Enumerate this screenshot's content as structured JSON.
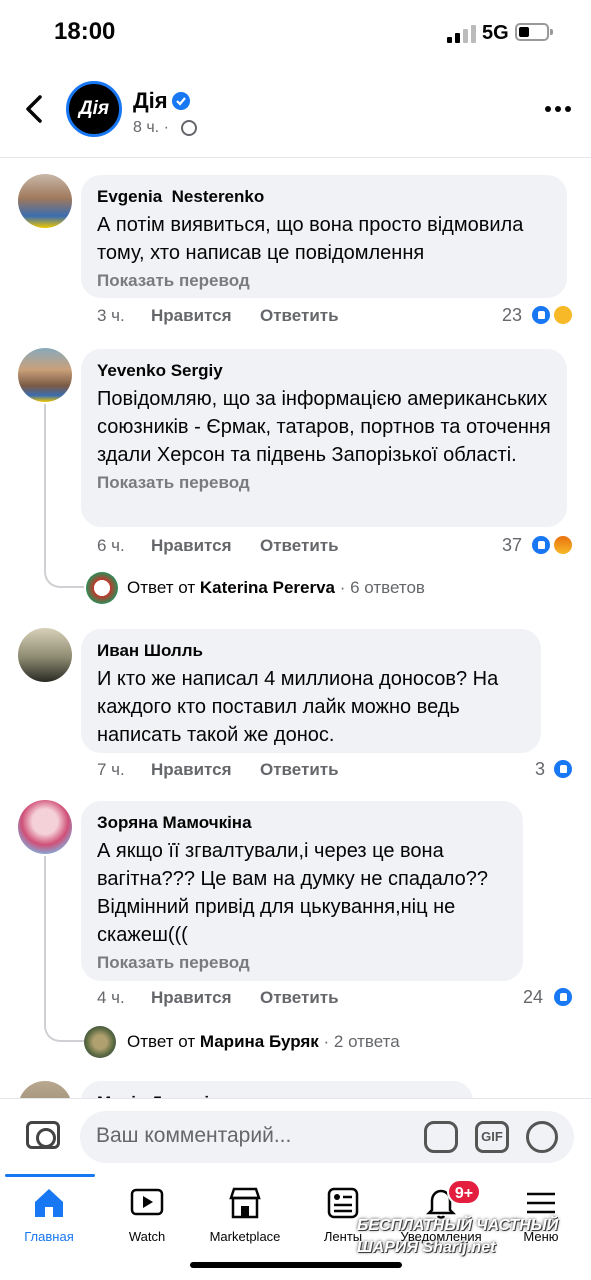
{
  "status_bar": {
    "time": "18:00",
    "network": "5G"
  },
  "header": {
    "page_name": "Дія",
    "avatar_text": "Дія",
    "meta": "8 ч. ·"
  },
  "comments": [
    {
      "author": "Evgenia  Nesterenko",
      "text": "А потім виявиться, що вона просто відмовила тому, хто написав  це повідомлення",
      "translate": "Показать перевод",
      "time": "3 ч.",
      "like": "Нравится",
      "reply": "Ответить",
      "reactions": "23"
    },
    {
      "author": "Yevenko Sergiy",
      "text": "Повідомляю, що за інформацією американських союзників - Єрмак, татаров, портнов та оточення здали Херсон та підвень Запорізької області.",
      "translate": "Показать перевод",
      "time": "6 ч.",
      "like": "Нравится",
      "reply": "Ответить",
      "reactions": "37",
      "replies": {
        "prefix": "Ответ от",
        "name": "Katerina Pererva",
        "count": " · 6 ответов"
      }
    },
    {
      "author": "Иван Шолль",
      "text": "И кто же написал 4 миллиона доносов? На каждого кто поставил лайк можно ведь написать такой же донос.",
      "time": "7 ч.",
      "like": "Нравится",
      "reply": "Ответить",
      "reactions": "3"
    },
    {
      "author": "Зоряна Мамочкіна",
      "text": "А якщо її згвалтували,і через це вона вагітна??? Це вам на думку не спадало?? Відмінний привід для цькування,ніц не скажеш(((",
      "translate": "Показать перевод",
      "time": "4 ч.",
      "like": "Нравится",
      "reply": "Ответить",
      "reactions": "24",
      "replies": {
        "prefix": "Ответ от",
        "name": "Марина Буряк",
        "count": " · 2 ответа"
      }
    },
    {
      "author": "Марія Дмитрієва"
    }
  ],
  "input": {
    "placeholder": "Ваш комментарий...",
    "gif_label": "GIF"
  },
  "nav": [
    {
      "label": "Главная",
      "icon": "home-icon"
    },
    {
      "label": "Watch",
      "icon": "watch-icon"
    },
    {
      "label": "Marketplace",
      "icon": "marketplace-icon"
    },
    {
      "label": "Ленты",
      "icon": "feeds-icon"
    },
    {
      "label": "Уведомления",
      "icon": "bell-icon",
      "badge": "9+"
    },
    {
      "label": "Меню",
      "icon": "menu-icon"
    }
  ],
  "watermark": {
    "line1": "БЕСПЛАТНЫЙ ЧАСТНЫЙ",
    "line2": "ШАРИЯ Sharij.net"
  },
  "colors": {
    "accent": "#1877f2",
    "bubble": "#f0f2f5",
    "badge": "#e41e3f"
  }
}
